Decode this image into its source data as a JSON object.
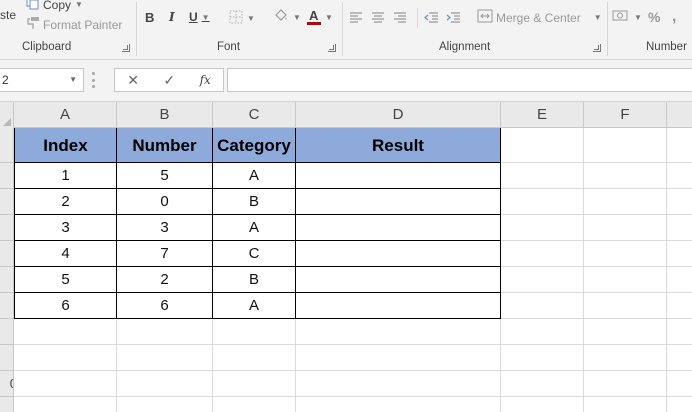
{
  "ribbon": {
    "clipboard": {
      "paste_label": "ste",
      "copy_label": "Copy",
      "format_painter_label": "Format Painter",
      "group_label": "Clipboard"
    },
    "font": {
      "bold": "B",
      "italic": "I",
      "underline": "U",
      "font_color_glyph": "A",
      "group_label": "Font"
    },
    "alignment": {
      "merge_center_label": "Merge & Center",
      "group_label": "Alignment"
    },
    "number": {
      "percent": "%",
      "group_label": "Number"
    }
  },
  "formula_bar": {
    "name_box": "2",
    "cancel": "✕",
    "enter": "✓",
    "fx": "fx",
    "formula": ""
  },
  "columns": [
    "A",
    "B",
    "C",
    "D",
    "E",
    "F"
  ],
  "rows": [
    "",
    "",
    "",
    "",
    "",
    "",
    "",
    "",
    "",
    "0",
    ""
  ],
  "table": {
    "headers": [
      "Index",
      "Number",
      "Category",
      "Result"
    ],
    "rows": [
      [
        "1",
        "5",
        "A",
        ""
      ],
      [
        "2",
        "0",
        "B",
        ""
      ],
      [
        "3",
        "3",
        "A",
        ""
      ],
      [
        "4",
        "7",
        "C",
        ""
      ],
      [
        "5",
        "2",
        "B",
        ""
      ],
      [
        "6",
        "6",
        "A",
        ""
      ]
    ]
  },
  "colors": {
    "header_fill": "#8eaadb",
    "font_color_bar": "#c00000"
  }
}
